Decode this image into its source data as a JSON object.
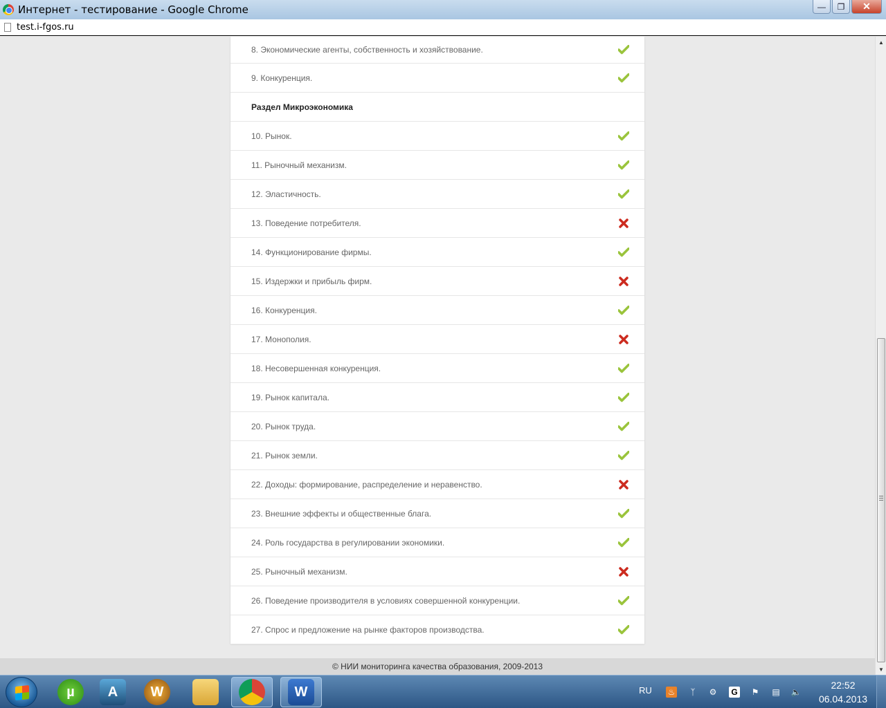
{
  "window": {
    "title": "Интернет - тестирование - Google Chrome"
  },
  "urlbar": {
    "url": "test.i-fgos.ru"
  },
  "rows": [
    {
      "label": "8. Экономические агенты, собственность и хозяйствование.",
      "status": "correct"
    },
    {
      "label": "9. Конкуренция.",
      "status": "correct"
    },
    {
      "label": "Раздел Микроэкономика",
      "status": "section"
    },
    {
      "label": "10. Рынок.",
      "status": "correct"
    },
    {
      "label": "11. Рыночный механизм.",
      "status": "correct"
    },
    {
      "label": "12. Эластичность.",
      "status": "correct"
    },
    {
      "label": "13. Поведение потребителя.",
      "status": "wrong"
    },
    {
      "label": "14. Функционирование фирмы.",
      "status": "correct"
    },
    {
      "label": "15. Издержки и прибыль фирм.",
      "status": "wrong"
    },
    {
      "label": "16. Конкуренция.",
      "status": "correct"
    },
    {
      "label": "17. Монополия.",
      "status": "wrong"
    },
    {
      "label": "18. Несовершенная конкуренция.",
      "status": "correct"
    },
    {
      "label": "19. Рынок капитала.",
      "status": "correct"
    },
    {
      "label": "20. Рынок труда.",
      "status": "correct"
    },
    {
      "label": "21. Рынок земли.",
      "status": "correct"
    },
    {
      "label": "22. Доходы: формирование, распределение и неравенство.",
      "status": "wrong"
    },
    {
      "label": "23. Внешние эффекты и общественные блага.",
      "status": "correct"
    },
    {
      "label": "24. Роль государства в регулировании экономики.",
      "status": "correct"
    },
    {
      "label": "25. Рыночный механизм.",
      "status": "wrong"
    },
    {
      "label": "26. Поведение производителя в условиях совершенной конкуренции.",
      "status": "correct"
    },
    {
      "label": "27. Спрос и предложение на рынке факторов производства.",
      "status": "correct"
    }
  ],
  "footer": {
    "text": "© НИИ мониторинга качества образования, 2009-2013"
  },
  "colors": {
    "correct": "#9ac43c",
    "wrong": "#cc2b1f"
  },
  "taskbar": {
    "items": [
      {
        "icon": "utorrent-icon",
        "letter": "µ"
      },
      {
        "icon": "aion-game-icon",
        "letter": "A"
      },
      {
        "icon": "warcraft-icon",
        "letter": "W"
      },
      {
        "icon": "folder-icon",
        "letter": ""
      },
      {
        "icon": "chrome-icon",
        "letter": ""
      },
      {
        "icon": "word-icon",
        "letter": "W"
      }
    ],
    "lang": "RU",
    "time": "22:52",
    "date": "06.04.2013"
  }
}
